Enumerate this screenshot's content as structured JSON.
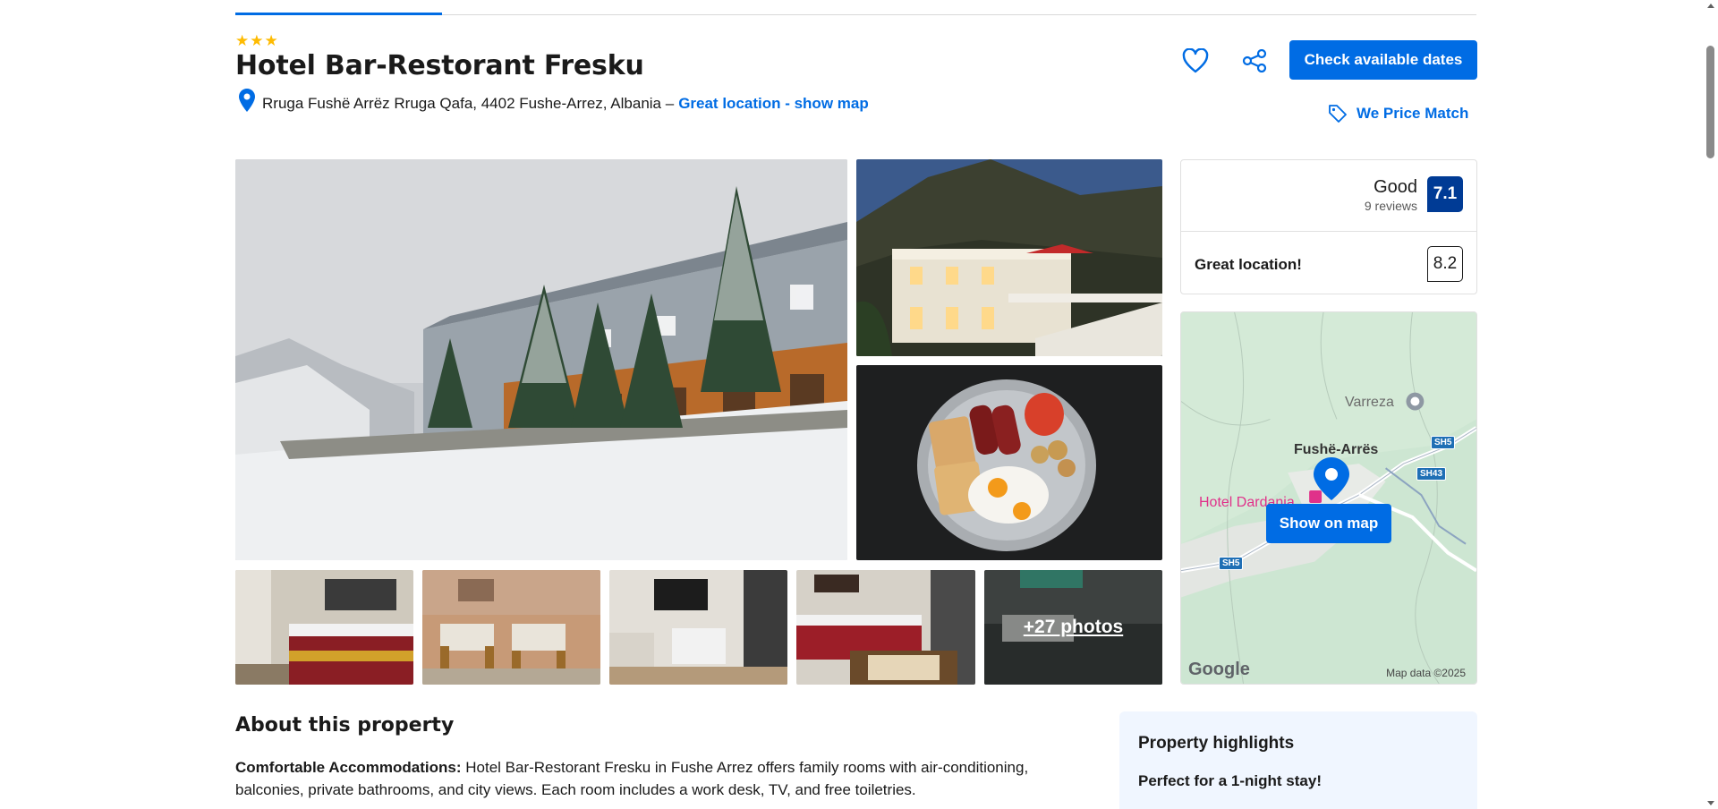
{
  "header": {
    "star_count": 3,
    "title": "Hotel Bar-Restorant Fresku",
    "address": "Rruga Fushë Arrëz Rruga Qafa, 4402 Fushe-Arrez, Albania –",
    "location_link": "Great location - show map",
    "check_dates_label": "Check available dates",
    "price_match_label": "We Price Match"
  },
  "photos": {
    "more_label": "+27 photos"
  },
  "review": {
    "word": "Good",
    "count": "9 reviews",
    "score": "7.1",
    "location_label": "Great location!",
    "location_score": "8.2"
  },
  "map": {
    "labels": {
      "varreza": "Varreza",
      "town": "Fushë-Arrës",
      "hotel": "Hotel Dardania"
    },
    "road_shields": [
      "SH5",
      "SH43",
      "SH5"
    ],
    "show_on_map_label": "Show on map",
    "google": "Google",
    "map_data": "Map data ©2025"
  },
  "about": {
    "title": "About this property",
    "lead_bold": "Comfortable Accommodations:",
    "text": "Hotel Bar-Restorant Fresku in Fushe Arrez offers family rooms with air-conditioning, balconies, private bathrooms, and city views. Each room includes a work desk, TV, and free toiletries."
  },
  "highlights": {
    "title": "Property highlights",
    "subtitle": "Perfect for a 1-night stay!"
  },
  "colors": {
    "brand_blue": "#006ce4",
    "score_blue": "#003b95",
    "star_yellow": "#febb02",
    "highlight_bg": "#f0f6ff"
  },
  "icons": {
    "star": "star-icon",
    "location": "map-pin-icon",
    "favorite": "heart-icon",
    "share": "share-icon",
    "price_tag": "tag-icon"
  }
}
